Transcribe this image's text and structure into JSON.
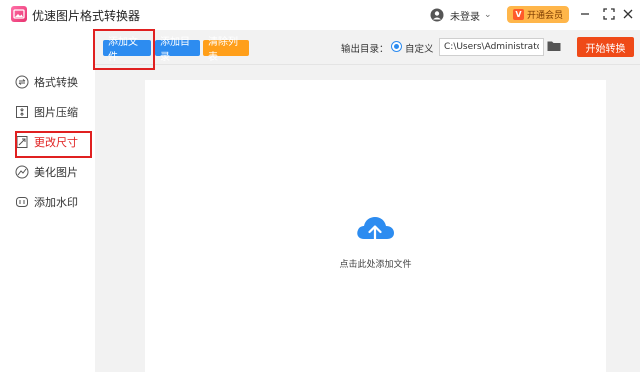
{
  "app": {
    "title": "优速图片格式转换器",
    "brand_color": "#e8336f"
  },
  "titlebar": {
    "user_label": "未登录",
    "vip_label": "开通会员",
    "vip_icon_text": "V"
  },
  "toolbar": {
    "add_file_label": "添加文件",
    "add_dir_label": "添加目录",
    "clear_label": "清除列表",
    "output_dir_label": "输出目录：",
    "custom_label": "自定义",
    "output_path_value": "C:\\Users\\Administrator\\",
    "start_label": "开始转换"
  },
  "sidebar": {
    "items": [
      {
        "label": "格式转换",
        "icon": "convert-icon"
      },
      {
        "label": "图片压缩",
        "icon": "compress-icon"
      },
      {
        "label": "更改尺寸",
        "icon": "resize-icon"
      },
      {
        "label": "美化图片",
        "icon": "beautify-icon"
      },
      {
        "label": "添加水印",
        "icon": "watermark-icon"
      }
    ],
    "active_index": 2
  },
  "main": {
    "drop_label": "点击此处添加文件"
  },
  "colors": {
    "primary": "#2d8cf0",
    "warning": "#ff9f1a",
    "start": "#ef4a18",
    "highlight": "#e02020",
    "vip": "#ffb64a"
  }
}
